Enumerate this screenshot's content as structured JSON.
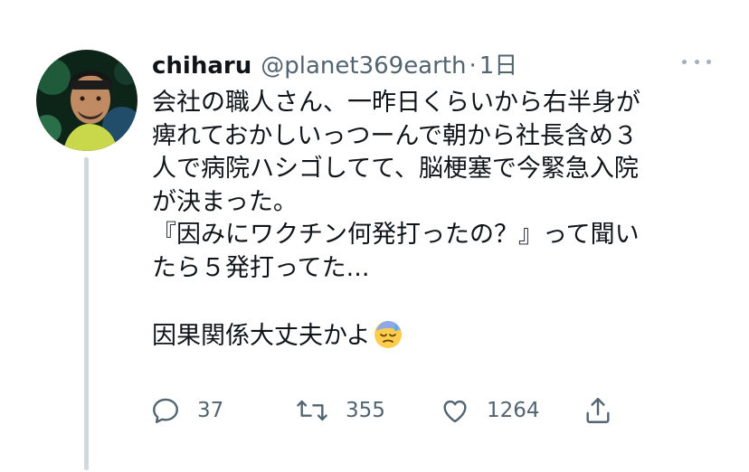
{
  "tweet": {
    "display_name": "chiharu",
    "handle": "@planet369earth",
    "separator": "·",
    "time_ago": "1日",
    "lines": [
      "会社の職人さん、一昨日くらいから右半身が",
      "痺れておかしいっつーんで朝から社長含め３",
      "人で病院ハシゴしてて、脳梗塞で今緊急入院",
      "が決まった。",
      "『因みにワクチン何発打ったの？』って聞い",
      "たら５発打ってた...",
      "",
      "因果関係大丈夫かよ"
    ],
    "emoji": "downcast-face-with-sweat-emoji"
  },
  "actions": {
    "reply_count": "37",
    "retweet_count": "355",
    "like_count": "1264"
  },
  "colors": {
    "text": "#0f1419",
    "secondary": "#536471",
    "thread_line": "#cfd9de"
  }
}
